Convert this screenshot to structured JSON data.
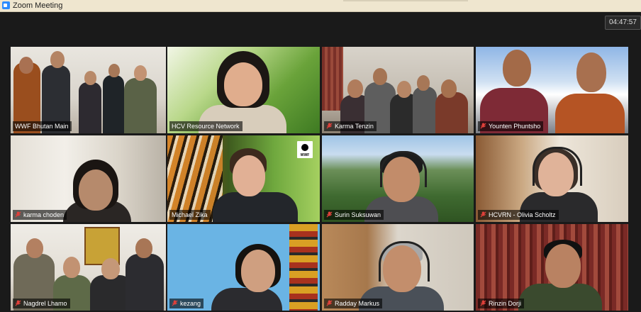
{
  "window": {
    "title": "Zoom Meeting",
    "icon": "zoom-camera-icon"
  },
  "meeting": {
    "elapsed_time": "04:47:57"
  },
  "participants": [
    {
      "name": "WWF Bhutan Main",
      "muted": false,
      "active_speaker": true
    },
    {
      "name": "HCV Resource Network",
      "muted": false,
      "active_speaker": false
    },
    {
      "name": "Karma Tenzin",
      "muted": true,
      "active_speaker": false
    },
    {
      "name": "Younten Phuntsho",
      "muted": true,
      "active_speaker": false
    },
    {
      "name": "karma choden",
      "muted": true,
      "active_speaker": false
    },
    {
      "name": "Michael Zika",
      "muted": false,
      "active_speaker": false
    },
    {
      "name": "Surin Suksuwan",
      "muted": true,
      "active_speaker": false
    },
    {
      "name": "HCVRN - Olivia Scholtz",
      "muted": true,
      "active_speaker": false
    },
    {
      "name": "Nagdrel Lhamo",
      "muted": true,
      "active_speaker": false
    },
    {
      "name": "kezang",
      "muted": true,
      "active_speaker": false
    },
    {
      "name": "Radday Markus",
      "muted": true,
      "active_speaker": false
    },
    {
      "name": "Rinzin Dorji",
      "muted": true,
      "active_speaker": false
    }
  ],
  "colors": {
    "active_speaker_border": "#d6e24a",
    "muted_mic": "#e0403a",
    "name_tag_bg": "rgba(0,0,0,0.6)"
  }
}
